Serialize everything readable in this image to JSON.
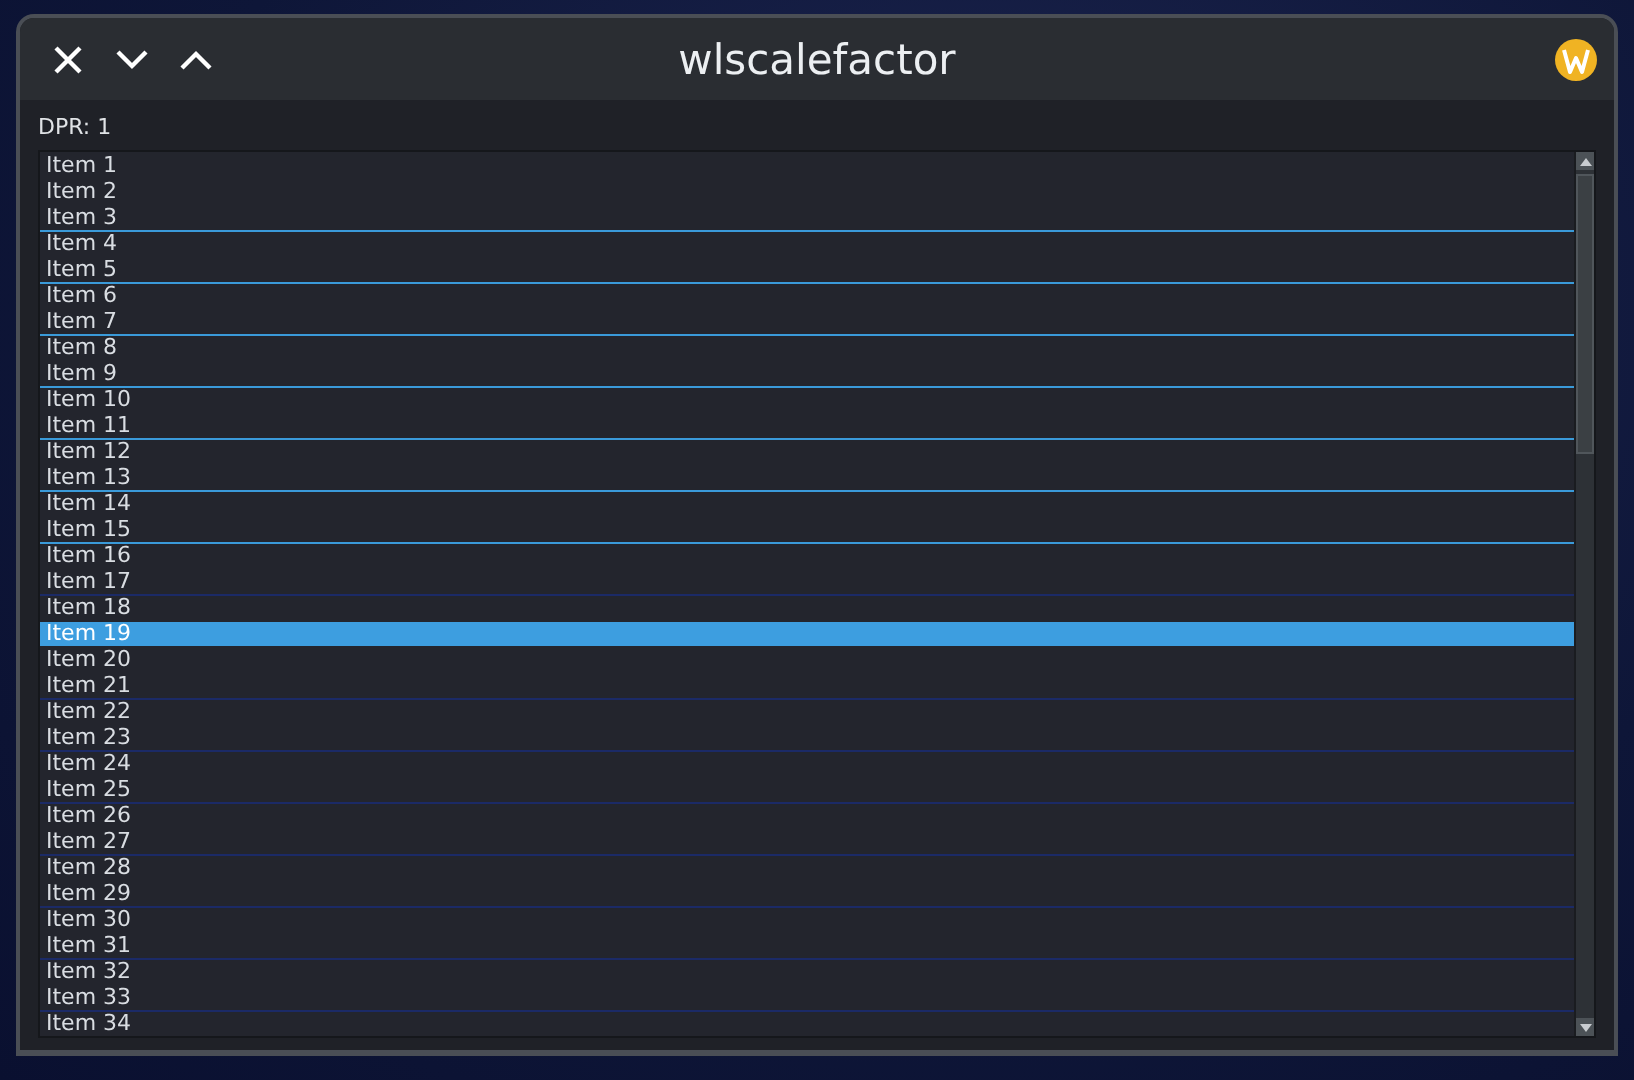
{
  "window": {
    "title": "wlscalefactor"
  },
  "dpr_label": "DPR: 1",
  "list": {
    "items": [
      {
        "label": "Item 1",
        "selected": false
      },
      {
        "label": "Item 2",
        "selected": false
      },
      {
        "label": "Item 3",
        "selected": false
      },
      {
        "label": "Item 4",
        "selected": false,
        "color": "#3a9ad9"
      },
      {
        "label": "Item 5",
        "selected": false
      },
      {
        "label": "Item 6",
        "selected": false,
        "color": "#3a9ad9"
      },
      {
        "label": "Item 7",
        "selected": false
      },
      {
        "label": "Item 8",
        "selected": false,
        "color": "#3a9ad9"
      },
      {
        "label": "Item 9",
        "selected": false
      },
      {
        "label": "Item 10",
        "selected": false,
        "color": "#3a9ad9"
      },
      {
        "label": "Item 11",
        "selected": false
      },
      {
        "label": "Item 12",
        "selected": false,
        "color": "#3a9ad9"
      },
      {
        "label": "Item 13",
        "selected": false
      },
      {
        "label": "Item 14",
        "selected": false,
        "color": "#3a9ad9"
      },
      {
        "label": "Item 15",
        "selected": false
      },
      {
        "label": "Item 16",
        "selected": false,
        "color": "#3a9ad9"
      },
      {
        "label": "Item 17",
        "selected": false
      },
      {
        "label": "Item 18",
        "selected": false,
        "color": "#1b2a66"
      },
      {
        "label": "Item 19",
        "selected": true
      },
      {
        "label": "Item 20",
        "selected": false
      },
      {
        "label": "Item 21",
        "selected": false
      },
      {
        "label": "Item 22",
        "selected": false,
        "color": "#1b2a66"
      },
      {
        "label": "Item 23",
        "selected": false
      },
      {
        "label": "Item 24",
        "selected": false,
        "color": "#1b2a66"
      },
      {
        "label": "Item 25",
        "selected": false
      },
      {
        "label": "Item 26",
        "selected": false,
        "color": "#1b2a66"
      },
      {
        "label": "Item 27",
        "selected": false
      },
      {
        "label": "Item 28",
        "selected": false,
        "color": "#1b2a66"
      },
      {
        "label": "Item 29",
        "selected": false
      },
      {
        "label": "Item 30",
        "selected": false,
        "color": "#1b2a66"
      },
      {
        "label": "Item 31",
        "selected": false
      },
      {
        "label": "Item 32",
        "selected": false,
        "color": "#1b2a66"
      },
      {
        "label": "Item 33",
        "selected": false
      },
      {
        "label": "Item 34",
        "selected": false,
        "color": "#1b2a66"
      }
    ]
  }
}
